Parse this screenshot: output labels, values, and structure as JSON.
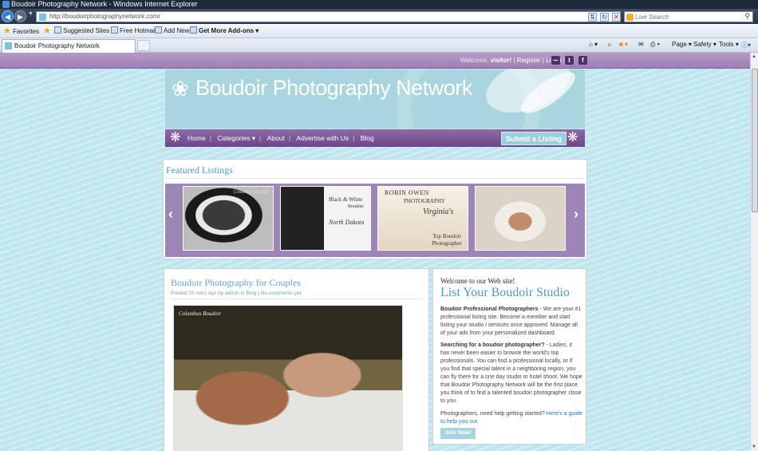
{
  "browser": {
    "title": "Boudoir Photography Network - Windows Internet Explorer",
    "url": "http://boudoirphotographynetwork.com/",
    "search_placeholder": "Live Search",
    "favorites": [
      "Favorites",
      "Suggested Sites ▾",
      "Free Hotmail",
      "Add New",
      "Get More Add-ons ▾"
    ],
    "tab_title": "Boudoir Photography Network",
    "commands": [
      "Page ▾",
      "Safety ▾",
      "Tools ▾"
    ]
  },
  "topbar": {
    "welcome": "Welcome,",
    "user": "visitor!",
    "register": "Register",
    "login": "Login",
    "social": [
      "RSS",
      "t",
      "f"
    ]
  },
  "header": {
    "logo_text": "Boudoir Photography Network"
  },
  "nav": {
    "items": [
      "Home",
      "Categories ▾",
      "About",
      "Advertise with Us",
      "Blog"
    ],
    "submit": "Submit a Listing"
  },
  "featured": {
    "heading": "Featured Listings",
    "thumbs": [
      {
        "caption": "Columbus Boudoir"
      },
      {
        "caption_top": "Black & White",
        "caption_mid": "Boudoir",
        "caption_bottom": "North Dakota"
      },
      {
        "caption_top": "Robin Owen",
        "caption_mid": "Photography",
        "caption_script": "Virginia's",
        "caption_bottom": "Top Boudoir Photographer"
      },
      {
        "caption": ""
      }
    ]
  },
  "post": {
    "title": "Boudoir Photography for Couples",
    "meta_prefix": "Posted 20 mins ago by",
    "author": "admin",
    "meta_mid": "in",
    "category": "Blog",
    "comments": "No comments yet",
    "watermark": "Columbus Boudoir"
  },
  "aside": {
    "welcome": "Welcome to our Web site!",
    "heading": "List Your Boudoir Studio",
    "p1_bold": "Boudoir Professional Photographers",
    "p1": " - We are your #1 professional listing site. Become a member and start listing your studio / services once approved. Manage all of your ads from your personalized dashboard.",
    "p2_bold": "Searching for a boudoir photographer?",
    "p2": " - Ladies, it has never been easier to browse the world's top professionals. You can find a professional locally, or if you find that special talent in a neighboring region, you can fly there for a one day studio or hotel shoot. We hope that Boudoir Photography Network will be the first place you think of to find a talented boudoir photographer close to you.",
    "p3": "Photographers, need help getting started?",
    "p3_link": "Here's a guide to help you out.",
    "join": "Join Now!"
  }
}
